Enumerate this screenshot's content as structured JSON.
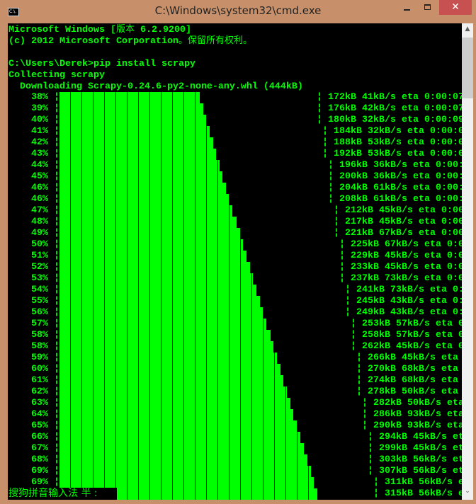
{
  "window": {
    "title": "C:\\Windows\\system32\\cmd.exe",
    "icon_label": "C:\\.",
    "minimize_icon": "minimize-icon",
    "maximize_icon": "maximize-icon",
    "close_label": "✕"
  },
  "console": {
    "lines": [
      {
        "text": "Microsoft Windows [",
        "cjk": "版本",
        "rest": " 6.2.9200]"
      },
      {
        "text": "(c) 2012 Microsoft Corporation",
        "cjk": "。保留所有权利。",
        "rest": ""
      },
      {
        "text": "",
        "cjk": "",
        "rest": ""
      },
      {
        "text": "C:\\Users\\Derek>pip install scrapy",
        "cjk": "",
        "rest": ""
      },
      {
        "text": "Collecting scrapy",
        "cjk": "",
        "rest": ""
      },
      {
        "text": "  Downloading Scrapy-0.24.6-py2-none-any.whl (444kB)",
        "cjk": "",
        "rest": ""
      }
    ],
    "text_color": "#00ff00",
    "background": "#000000",
    "progress_rows": [
      {
        "pct": "38%",
        "kb": 172,
        "status": "¦ 172kB 41kB/s eta 0:00:07"
      },
      {
        "pct": "39%",
        "kb": 176,
        "status": "¦ 176kB 42kB/s eta 0:00:07"
      },
      {
        "pct": "40%",
        "kb": 180,
        "status": "¦ 180kB 32kB/s eta 0:00:09"
      },
      {
        "pct": "41%",
        "kb": 184,
        "status": "¦ 184kB 32kB/s eta 0:00:0"
      },
      {
        "pct": "42%",
        "kb": 188,
        "status": "¦ 188kB 53kB/s eta 0:00:0"
      },
      {
        "pct": "43%",
        "kb": 192,
        "status": "¦ 192kB 53kB/s eta 0:00:0"
      },
      {
        "pct": "44%",
        "kb": 196,
        "status": "¦ 196kB 36kB/s eta 0:00:"
      },
      {
        "pct": "45%",
        "kb": 200,
        "status": "¦ 200kB 36kB/s eta 0:00:"
      },
      {
        "pct": "46%",
        "kb": 204,
        "status": "¦ 204kB 61kB/s eta 0:00:"
      },
      {
        "pct": "46%",
        "kb": 208,
        "status": "¦ 208kB 61kB/s eta 0:00:"
      },
      {
        "pct": "47%",
        "kb": 212,
        "status": "¦ 212kB 45kB/s eta 0:00"
      },
      {
        "pct": "48%",
        "kb": 217,
        "status": "¦ 217kB 45kB/s eta 0:00"
      },
      {
        "pct": "49%",
        "kb": 221,
        "status": "¦ 221kB 67kB/s eta 0:00"
      },
      {
        "pct": "50%",
        "kb": 225,
        "status": "¦ 225kB 67kB/s eta 0:0"
      },
      {
        "pct": "51%",
        "kb": 229,
        "status": "¦ 229kB 45kB/s eta 0:0"
      },
      {
        "pct": "52%",
        "kb": 233,
        "status": "¦ 233kB 45kB/s eta 0:0"
      },
      {
        "pct": "53%",
        "kb": 237,
        "status": "¦ 237kB 73kB/s eta 0:0"
      },
      {
        "pct": "54%",
        "kb": 241,
        "status": "¦ 241kB 73kB/s eta 0:"
      },
      {
        "pct": "55%",
        "kb": 245,
        "status": "¦ 245kB 43kB/s eta 0:"
      },
      {
        "pct": "56%",
        "kb": 249,
        "status": "¦ 249kB 43kB/s eta 0:"
      },
      {
        "pct": "57%",
        "kb": 253,
        "status": "¦ 253kB 57kB/s eta 0"
      },
      {
        "pct": "58%",
        "kb": 258,
        "status": "¦ 258kB 57kB/s eta 0"
      },
      {
        "pct": "58%",
        "kb": 262,
        "status": "¦ 262kB 45kB/s eta 0"
      },
      {
        "pct": "59%",
        "kb": 266,
        "status": "¦ 266kB 45kB/s eta"
      },
      {
        "pct": "60%",
        "kb": 270,
        "status": "¦ 270kB 68kB/s eta"
      },
      {
        "pct": "61%",
        "kb": 274,
        "status": "¦ 274kB 68kB/s eta"
      },
      {
        "pct": "62%",
        "kb": 278,
        "status": "¦ 278kB 50kB/s eta"
      },
      {
        "pct": "63%",
        "kb": 282,
        "status": "¦ 282kB 50kB/s eta"
      },
      {
        "pct": "64%",
        "kb": 286,
        "status": "¦ 286kB 93kB/s eta"
      },
      {
        "pct": "65%",
        "kb": 290,
        "status": "¦ 290kB 93kB/s eta"
      },
      {
        "pct": "66%",
        "kb": 294,
        "status": "¦ 294kB 45kB/s et"
      },
      {
        "pct": "67%",
        "kb": 299,
        "status": "¦ 299kB 45kB/s et"
      },
      {
        "pct": "68%",
        "kb": 303,
        "status": "¦ 303kB 56kB/s et"
      },
      {
        "pct": "69%",
        "kb": 307,
        "status": "¦ 307kB 56kB/s et"
      },
      {
        "pct": "69%",
        "kb": 311,
        "status": "¦ 311kB 56kB/s e"
      },
      {
        "pct": "",
        "kb": 315,
        "status": "¦ 315kB 56kB/s e"
      }
    ]
  },
  "ime": {
    "label": "搜狗拼音输入法 半 :"
  },
  "scrollbar": {
    "up_icon": "▲",
    "down_icon": "⌄"
  }
}
